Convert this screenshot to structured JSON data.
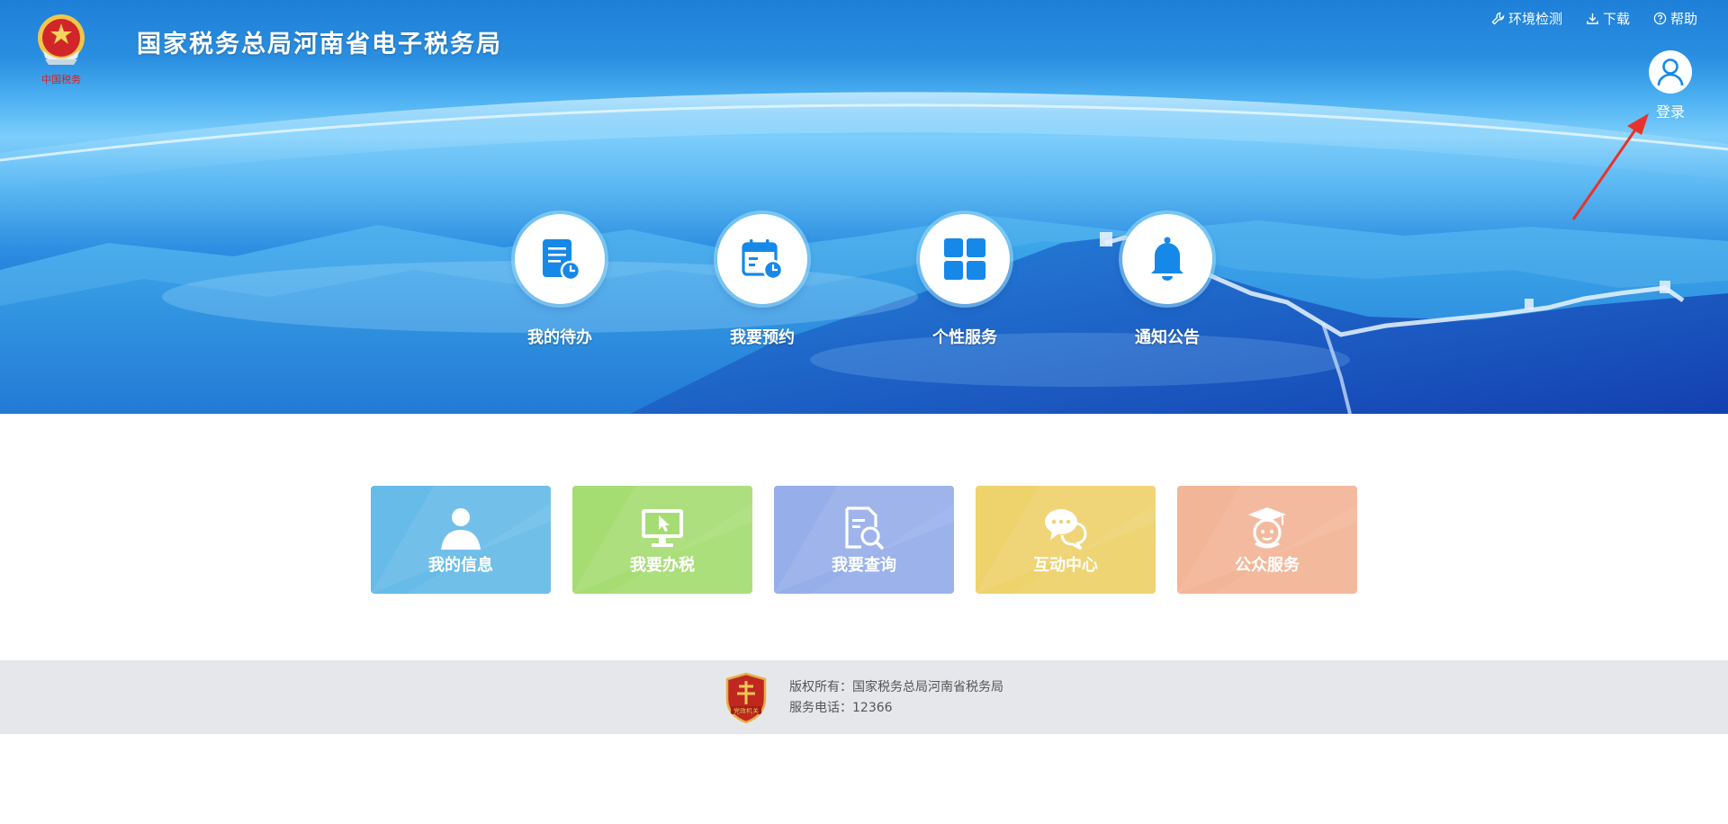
{
  "header": {
    "site_title": "国家税务总局河南省电子税务局",
    "emblem_text": "中国税务"
  },
  "util_links": [
    {
      "label": "环境检测",
      "icon": "wrench-icon"
    },
    {
      "label": "下载",
      "icon": "download-icon"
    },
    {
      "label": "帮助",
      "icon": "help-circle-icon"
    }
  ],
  "login": {
    "label": "登录",
    "icon": "user-icon"
  },
  "quick_entries": [
    {
      "label": "我的待办",
      "icon": "todo-document-clock-icon"
    },
    {
      "label": "我要预约",
      "icon": "calendar-clock-icon"
    },
    {
      "label": "个性服务",
      "icon": "grid-icon"
    },
    {
      "label": "通知公告",
      "icon": "bell-icon"
    }
  ],
  "tiles": [
    {
      "label": "我的信息",
      "icon": "person-icon",
      "color": "#67bbe8"
    },
    {
      "label": "我要办税",
      "icon": "monitor-cursor-icon",
      "color": "#a6dd73"
    },
    {
      "label": "我要查询",
      "icon": "document-search-icon",
      "color": "#96aeea"
    },
    {
      "label": "互动中心",
      "icon": "chat-bubbles-icon",
      "color": "#eed26c"
    },
    {
      "label": "公众服务",
      "icon": "graduate-icon",
      "color": "#f3b597"
    }
  ],
  "footer": {
    "copyright": "版权所有：国家税务总局河南省税务局",
    "phone": "服务电话：12366",
    "badge_text": "党政机关"
  },
  "colors": {
    "banner_blue": "#1e7fd8",
    "icon_blue": "#1688e8",
    "footer_bg": "#e6e7ea",
    "arrow_red": "#e8322c"
  }
}
